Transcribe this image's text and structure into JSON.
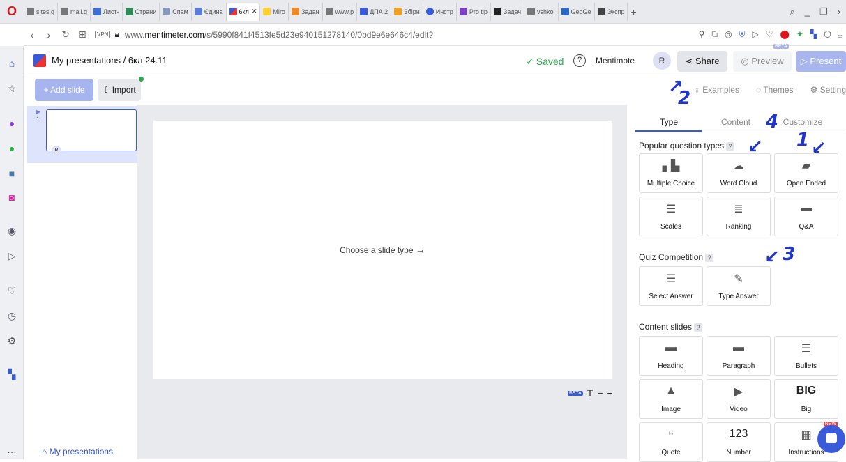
{
  "browser": {
    "tabs": [
      "sites.g",
      "mail.g",
      "Лист-",
      "Страни",
      "Спам",
      "Єдина",
      "6кл",
      "Miro",
      "Задан",
      "www.p",
      "ДПА 2",
      "Збірн",
      "Инстр",
      "Pro tip",
      "Задач",
      "vshkol",
      "GeoGe",
      "Экспр"
    ],
    "url_prefix": "www.",
    "url_domain": "mentimeter.com",
    "url_path": "/s/5990f841f4513fe5d23e940151278140/0bd9e6e646c4/edit?",
    "vpn": "VPN"
  },
  "header": {
    "breadcrumb": "My presentations / 6кл 24.11",
    "saved": "Saved",
    "mentimote": "Mentimote",
    "avatar": "R",
    "share": "Share",
    "preview": "Preview",
    "beta": "BETA",
    "present": "Present"
  },
  "toolbar": {
    "add_slide": "+ Add slide",
    "import": "Import",
    "examples": "Examples",
    "themes": "Themes",
    "settings": "Setting"
  },
  "slides": {
    "number": "1",
    "avatar": "R",
    "my_presentations": "My presentations"
  },
  "canvas": {
    "choose": "Choose a slide type",
    "beta": "BETA"
  },
  "panel": {
    "tabs": [
      "Type",
      "Content",
      "Customize"
    ],
    "popular_title": "Popular question types",
    "popular": [
      {
        "label": "Multiple Choice",
        "icon": "bar-chart-icon"
      },
      {
        "label": "Word Cloud",
        "icon": "word-cloud-icon"
      },
      {
        "label": "Open Ended",
        "icon": "speech-bubbles-icon"
      },
      {
        "label": "Scales",
        "icon": "scales-icon"
      },
      {
        "label": "Ranking",
        "icon": "ranking-icon"
      },
      {
        "label": "Q&A",
        "icon": "qa-bubble-icon"
      }
    ],
    "quiz_title": "Quiz Competition",
    "quiz": [
      {
        "label": "Select Answer",
        "icon": "lines-icon"
      },
      {
        "label": "Type Answer",
        "icon": "pen-icon"
      }
    ],
    "content_title": "Content slides",
    "content": [
      {
        "label": "Heading",
        "icon": "heading-icon"
      },
      {
        "label": "Paragraph",
        "icon": "paragraph-icon"
      },
      {
        "label": "Bullets",
        "icon": "bullets-icon"
      },
      {
        "label": "Image",
        "icon": "image-icon"
      },
      {
        "label": "Video",
        "icon": "video-icon"
      },
      {
        "label": "Big",
        "icon": "big-text-icon",
        "glyph": "BIG"
      },
      {
        "label": "Quote",
        "icon": "quote-icon"
      },
      {
        "label": "Number",
        "icon": "number-icon",
        "glyph": "123"
      },
      {
        "label": "Instructions",
        "icon": "qr-icon",
        "badge": "NEW"
      }
    ]
  },
  "annotations": [
    "1",
    "2",
    "3",
    "4"
  ]
}
